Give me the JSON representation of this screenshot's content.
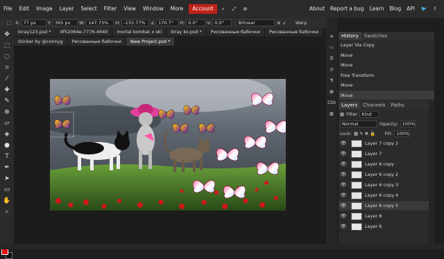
{
  "menu": {
    "items": [
      "File",
      "Edit",
      "Image",
      "Layer",
      "Select",
      "Filter",
      "View",
      "Window",
      "More"
    ],
    "account": "Account",
    "right_links": [
      "About",
      "Report a bug",
      "Learn",
      "Blog",
      "API"
    ]
  },
  "options": {
    "x": "77 px",
    "y": "365 px",
    "w": "147.73%",
    "h": "-133.77%",
    "angle": "170.7°",
    "skew_h": "0.0°",
    "skew_v": "0.0°",
    "interp": "Bilinear",
    "warp": "Warp"
  },
  "tabs_row1": [
    "kiray123.psd *",
    "4f52064e-7776-4640",
    "mortal kombat x skl",
    "kiray ko.psd *",
    "Рисованные бабочки",
    "Рисованные бабочки"
  ],
  "tabs_row2": [
    "Sticker by @connyg",
    "Рисованные бабочки",
    "New Project.psd *"
  ],
  "history": {
    "tabs": [
      "History",
      "Swatches"
    ],
    "items": [
      "Layer Via Copy",
      "Move",
      "Move",
      "Free Transform",
      "Move",
      "Move"
    ]
  },
  "layers": {
    "tabs": [
      "Layers",
      "Channels",
      "Paths"
    ],
    "filter_label": "Filter",
    "filter_value": "Kind",
    "blend": "Normal",
    "opacity_label": "Opacity:",
    "opacity": "100%",
    "lock_label": "Lock:",
    "fill_label": "Fill:",
    "fill": "100%",
    "items": [
      "Layer 7 copy 2",
      "Layer 7",
      "Layer 6 copy",
      "Layer 6 copy 2",
      "Layer 6 copy 3",
      "Layer 6 copy 4",
      "Layer 6 copy 5",
      "Layer 8",
      "Layer 6"
    ]
  },
  "iconbar": [
    "≡",
    "▭",
    "☰",
    "Ⓐ",
    "¶",
    "▤",
    "CSS",
    "▧"
  ],
  "colors": {
    "accent": "#c0221b",
    "fg": "#e01010",
    "bg": "#111111"
  }
}
